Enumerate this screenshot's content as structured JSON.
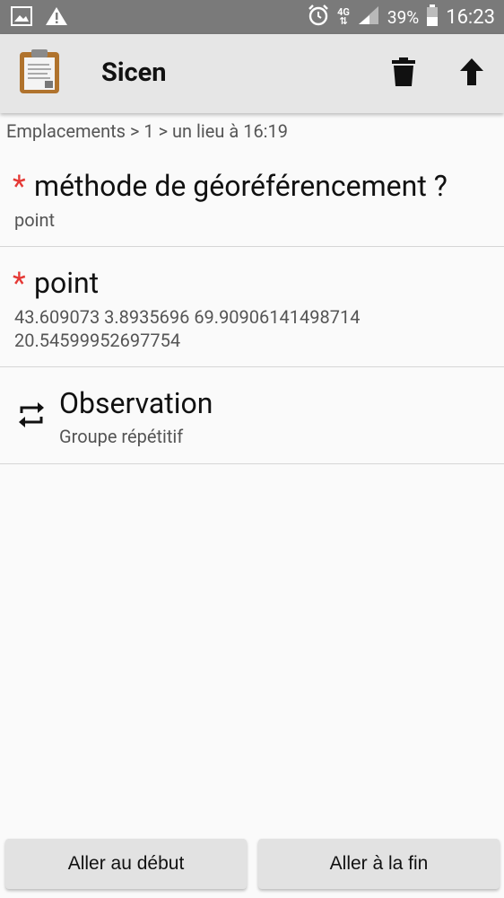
{
  "status_bar": {
    "network": "4G",
    "battery": "39%",
    "time": "16:23"
  },
  "app_bar": {
    "title": "Sicen",
    "icons": [
      "clipboard-icon",
      "delete-icon",
      "upload-icon"
    ]
  },
  "breadcrumb": "Emplacements > 1 > un lieu à 16:19",
  "questions": [
    {
      "required_mark": "*",
      "label": "méthode de géoréférencement ?",
      "value": "point"
    },
    {
      "required_mark": "*",
      "label": "point",
      "value_line1": "43.609073 3.8935696 69.90906141498714",
      "value_line2": "20.54599952697754"
    }
  ],
  "group": {
    "title": "Observation",
    "subtitle": "Groupe répétitif",
    "icon": "repeat-icon"
  },
  "buttons": {
    "start": "Aller au début",
    "end": "Aller à la fin"
  },
  "colors": {
    "status_bar": "#7a7a7a",
    "app_bar": "#e6e6e6",
    "required": "#e53935"
  }
}
